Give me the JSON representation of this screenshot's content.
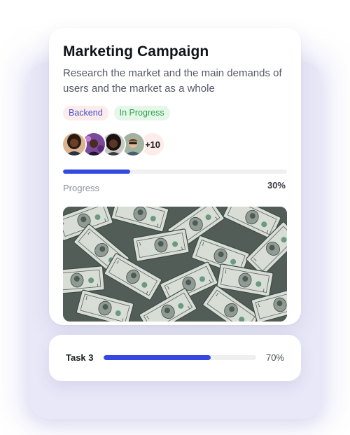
{
  "card": {
    "title": "Marketing Campaign",
    "description": "Research the market and the main demands of users and the market as a whole",
    "tags": [
      {
        "label": "Backend",
        "color": "#4450c8",
        "background": "#fdecec"
      },
      {
        "label": "In Progress",
        "color": "#2ba24c",
        "background": "#e6f7e9"
      }
    ],
    "members_more": "+10",
    "progress": {
      "label": "Progress",
      "value_text": "30%",
      "value": 0.3
    },
    "image_icon": "dollar-bills-photo"
  },
  "task": {
    "label": "Task 3",
    "value_text": "70%",
    "value": 0.7
  },
  "colors": {
    "accent": "#3349e0",
    "panel": "#e8e8f8"
  }
}
